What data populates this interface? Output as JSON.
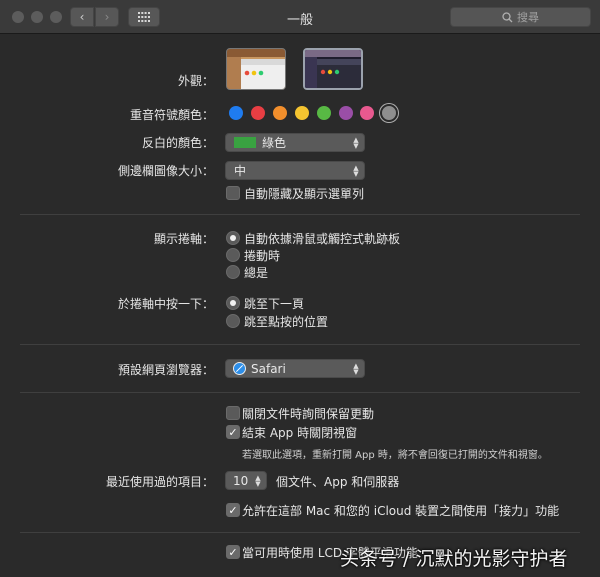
{
  "window": {
    "title": "一般",
    "search_placeholder": "搜尋"
  },
  "appearance": {
    "label": "外觀：",
    "options": [
      "light",
      "dark"
    ],
    "selected": "dark"
  },
  "accent": {
    "label": "重音符號顏色：",
    "colors": [
      "#1f7cf0",
      "#e83e43",
      "#f28f2c",
      "#f5c430",
      "#58b944",
      "#9a4ea7",
      "#e8598f",
      "#8e8e8e"
    ],
    "selected": "#8e8e8e"
  },
  "highlight": {
    "label": "反白的顏色：",
    "value": "綠色",
    "swatch": "#39a241"
  },
  "sidebar_icon": {
    "label": "側邊欄圖像大小：",
    "value": "中"
  },
  "auto_hide_menu": {
    "label": "自動隱藏及顯示選單列",
    "checked": false
  },
  "scrollbars": {
    "label": "顯示捲軸：",
    "options": [
      "自動依據滑鼠或觸控式軌跡板",
      "捲動時",
      "總是"
    ],
    "selected": 0
  },
  "click_scrollbar": {
    "label": "於捲軸中按一下：",
    "options": [
      "跳至下一頁",
      "跳至點按的位置"
    ],
    "selected": 0
  },
  "browser": {
    "label": "預設網頁瀏覽器：",
    "value": "Safari"
  },
  "ask_keep_changes": {
    "label": "關閉文件時詢問保留更動",
    "checked": false
  },
  "close_windows": {
    "label": "結束 App 時關閉視窗",
    "checked": true
  },
  "close_windows_note": "若選取此選項，重新打開 App 時，將不會回復已打開的文件和視窗。",
  "recent": {
    "label": "最近使用過的項目：",
    "value": "10",
    "suffix": "個文件、App 和伺服器"
  },
  "handoff": {
    "label": "允許在這部 Mac 和您的 iCloud 裝置之間使用「接力」功能",
    "checked": true
  },
  "lcd": {
    "label": "當可用時使用 LCD 字體平滑功能",
    "checked": true
  },
  "watermark": "头条号 / 沉默的光影守护者"
}
